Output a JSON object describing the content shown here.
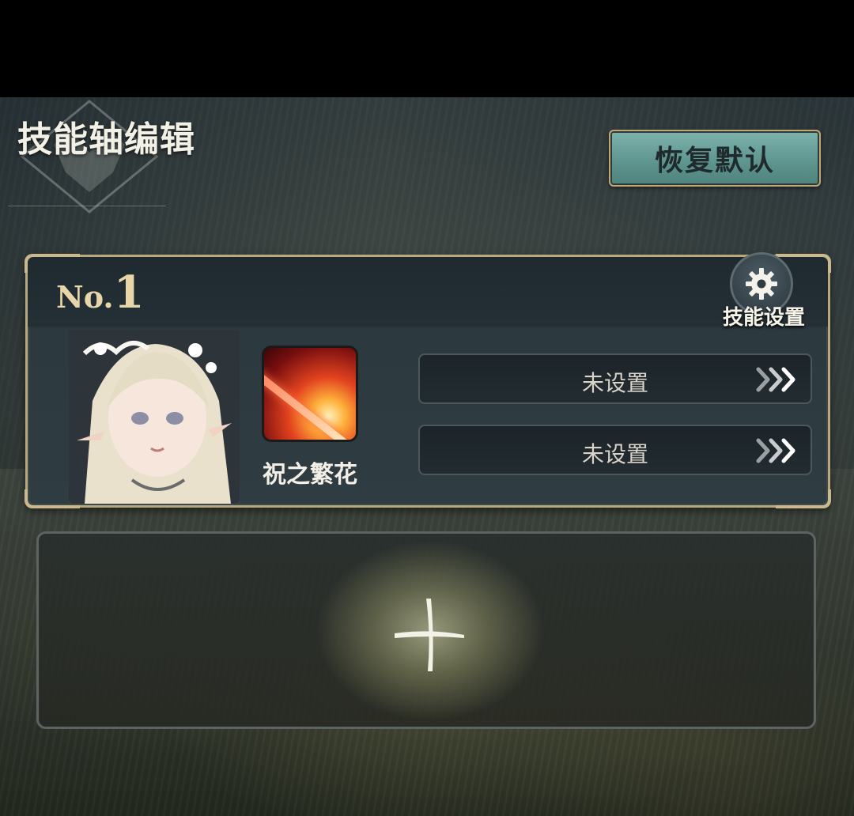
{
  "header": {
    "title": "技能轴编辑",
    "reset_label": "恢复默认"
  },
  "teams": [
    {
      "no_prefix": "No.",
      "number": "1",
      "settings_label": "技能设置",
      "skill_name": "祝之繁花",
      "slots": [
        {
          "label": "未设置"
        },
        {
          "label": "未设置"
        }
      ]
    }
  ],
  "icons": {
    "settings": "gear-icon",
    "slot_arrow": "triple-chevron-right-icon",
    "add": "plus-icon"
  },
  "colors": {
    "accent_gold": "#b9a87d",
    "button_teal": "#6aa39d",
    "text_light": "#f3f0e6"
  }
}
